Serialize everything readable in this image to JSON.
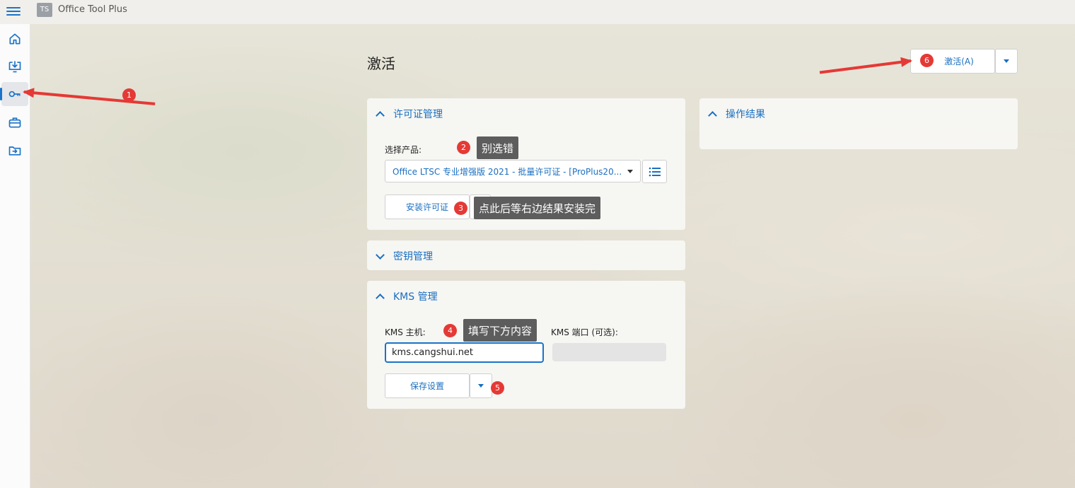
{
  "app": {
    "title": "Office Tool Plus",
    "logo_text": "TS"
  },
  "page": {
    "title": "激活"
  },
  "actions": {
    "activate_label": "激活(A)"
  },
  "license_card": {
    "title": "许可证管理",
    "select_product_label": "选择产品:",
    "selected_product": "Office LTSC 专业增强版 2021 - 批量许可证 - [ProPlus20...",
    "install_button": "安装许可证"
  },
  "key_card": {
    "title": "密钥管理"
  },
  "kms_card": {
    "title": "KMS 管理",
    "host_label": "KMS 主机:",
    "host_value": "kms.cangshui.net",
    "port_label": "KMS 端口 (可选):",
    "port_value": "",
    "save_button": "保存设置"
  },
  "result_card": {
    "title": "操作结果"
  },
  "annotations": {
    "b1": "1",
    "b2": "2",
    "b3": "3",
    "b4": "4",
    "b5": "5",
    "b6": "6",
    "tip2": "别选错",
    "tip3": "点此后等右边结果安装完",
    "tip4": "填写下方内容"
  },
  "colors": {
    "accent": "#1a73c8",
    "annotation": "#e53935",
    "tooltip": "#5d5d5d"
  },
  "icons": [
    "menu-icon",
    "home-icon",
    "download-icon",
    "key-icon",
    "toolbox-icon",
    "import-icon",
    "list-icon",
    "chevron-up-icon",
    "chevron-down-icon",
    "caret-down-icon"
  ]
}
